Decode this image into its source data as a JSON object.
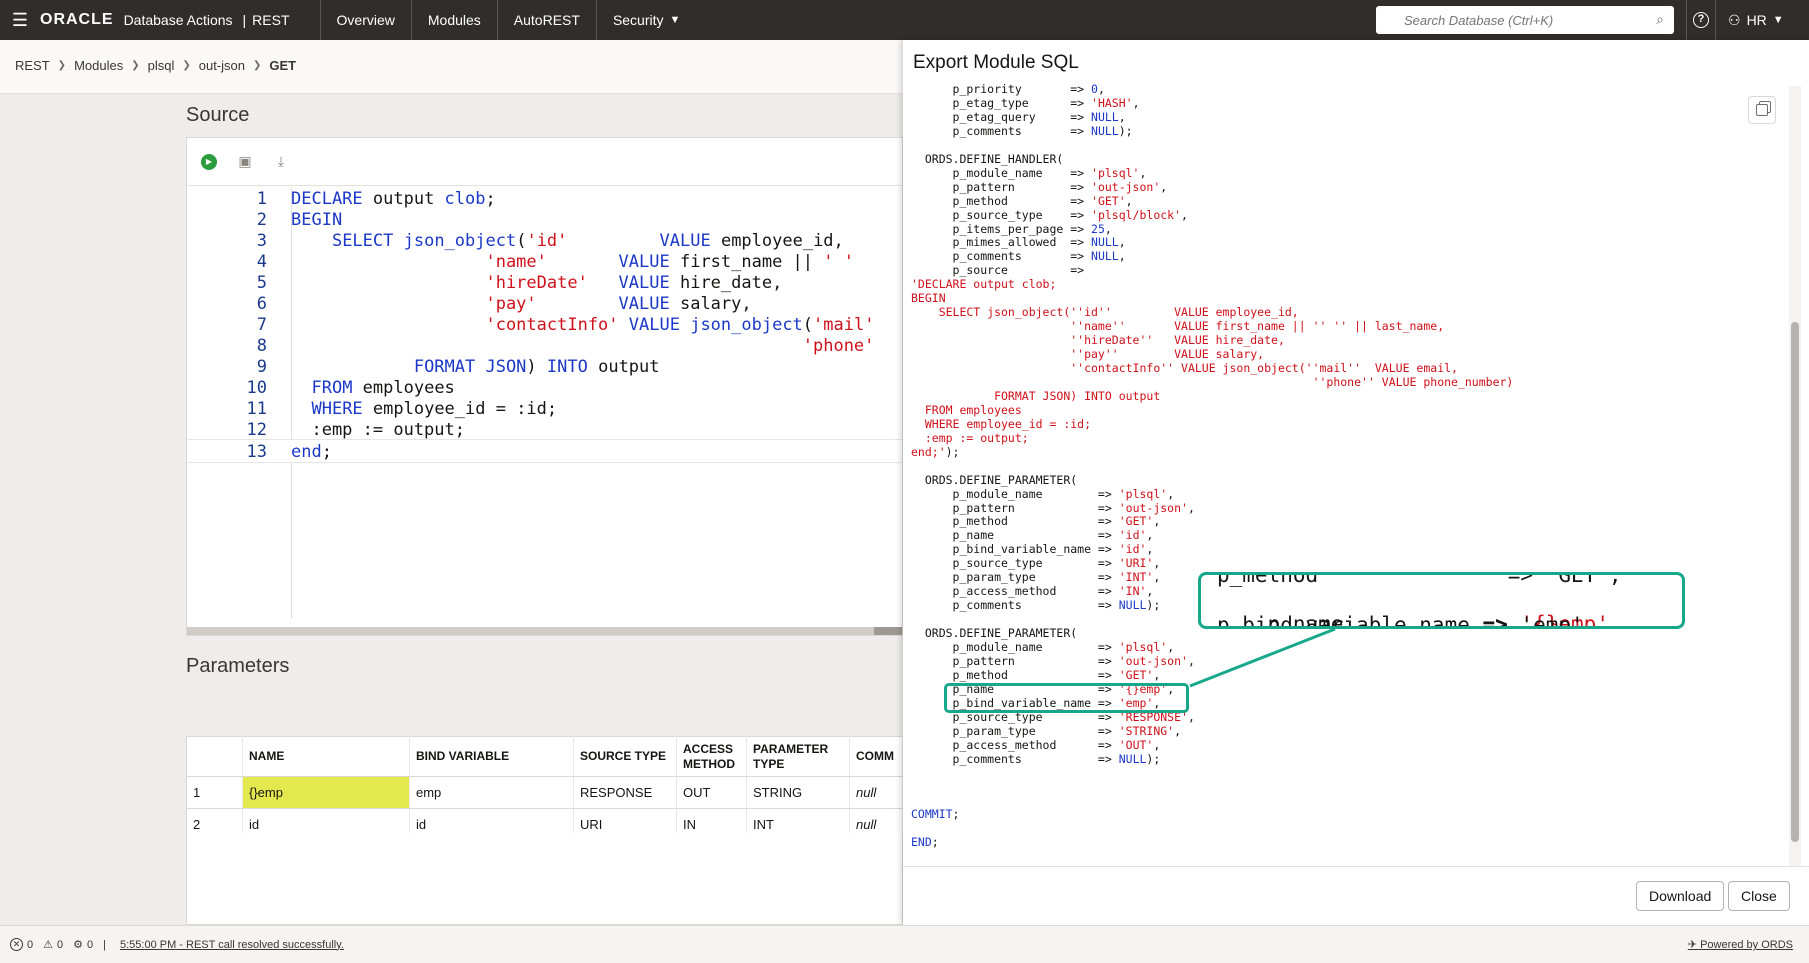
{
  "header": {
    "logo": "ORACLE",
    "app_name": "Database Actions",
    "app_sep": "|",
    "section": "REST",
    "tabs": [
      {
        "label": "Overview"
      },
      {
        "label": "Modules"
      },
      {
        "label": "AutoREST"
      },
      {
        "label": "Security"
      }
    ],
    "search_placeholder": "Search Database (Ctrl+K)",
    "help_label": "?",
    "user": "HR"
  },
  "breadcrumb": [
    "REST",
    "Modules",
    "plsql",
    "out-json",
    "GET"
  ],
  "source": {
    "title": "Source",
    "lines": [
      {
        "n": "1",
        "parts": [
          [
            "kw",
            "DECLARE "
          ],
          [
            "plain",
            "output "
          ],
          [
            "kw",
            "clob"
          ],
          [
            "plain",
            ";"
          ]
        ]
      },
      {
        "n": "2",
        "parts": [
          [
            "kw",
            "BEGIN"
          ]
        ]
      },
      {
        "n": "3",
        "parts": [
          [
            "plain",
            "    "
          ],
          [
            "kw",
            "SELECT "
          ],
          [
            "kw",
            "json_object"
          ],
          [
            "plain",
            "("
          ],
          [
            "str",
            "'id'"
          ],
          [
            "plain",
            "         "
          ],
          [
            "kw",
            "VALUE "
          ],
          [
            "plain",
            "employee_id,"
          ]
        ]
      },
      {
        "n": "4",
        "parts": [
          [
            "plain",
            "                   "
          ],
          [
            "str",
            "'name'"
          ],
          [
            "plain",
            "       "
          ],
          [
            "kw",
            "VALUE "
          ],
          [
            "plain",
            "first_name || "
          ],
          [
            "str",
            "' '"
          ]
        ]
      },
      {
        "n": "5",
        "parts": [
          [
            "plain",
            "                   "
          ],
          [
            "str",
            "'hireDate'"
          ],
          [
            "plain",
            "   "
          ],
          [
            "kw",
            "VALUE "
          ],
          [
            "plain",
            "hire_date,"
          ]
        ]
      },
      {
        "n": "6",
        "parts": [
          [
            "plain",
            "                   "
          ],
          [
            "str",
            "'pay'"
          ],
          [
            "plain",
            "        "
          ],
          [
            "kw",
            "VALUE "
          ],
          [
            "plain",
            "salary,"
          ]
        ]
      },
      {
        "n": "7",
        "parts": [
          [
            "plain",
            "                   "
          ],
          [
            "str",
            "'contactInfo'"
          ],
          [
            "plain",
            " "
          ],
          [
            "kw",
            "VALUE "
          ],
          [
            "kw",
            "json_object"
          ],
          [
            "plain",
            "("
          ],
          [
            "str",
            "'mail'"
          ]
        ]
      },
      {
        "n": "8",
        "parts": [
          [
            "plain",
            "                                                  "
          ],
          [
            "str",
            "'phone'"
          ]
        ]
      },
      {
        "n": "9",
        "parts": [
          [
            "plain",
            "            "
          ],
          [
            "kw",
            "FORMAT JSON"
          ],
          [
            "plain",
            ") "
          ],
          [
            "kw",
            "INTO "
          ],
          [
            "plain",
            "output"
          ]
        ]
      },
      {
        "n": "10",
        "parts": [
          [
            "plain",
            "  "
          ],
          [
            "kw",
            "FROM "
          ],
          [
            "plain",
            "employees"
          ]
        ]
      },
      {
        "n": "11",
        "parts": [
          [
            "plain",
            "  "
          ],
          [
            "kw",
            "WHERE "
          ],
          [
            "plain",
            "employee_id = :id;"
          ]
        ]
      },
      {
        "n": "12",
        "parts": [
          [
            "plain",
            "  :emp := output;"
          ]
        ]
      },
      {
        "n": "13",
        "parts": [
          [
            "kw",
            "end"
          ],
          [
            "plain",
            ";"
          ]
        ]
      }
    ]
  },
  "parameters": {
    "title": "Parameters",
    "columns": [
      "NAME",
      "BIND VARIABLE",
      "SOURCE TYPE",
      "ACCESS METHOD",
      "PARAMETER TYPE",
      "COMM"
    ],
    "rows": [
      {
        "num": "1",
        "name": "{}emp",
        "bind": "emp",
        "source": "RESPONSE",
        "access": "OUT",
        "ptype": "STRING",
        "comment": "null"
      },
      {
        "num": "2",
        "name": "id",
        "bind": "id",
        "source": "URI",
        "access": "IN",
        "ptype": "INT",
        "comment": "null"
      }
    ]
  },
  "drawer": {
    "title": "Export Module SQL",
    "download_label": "Download",
    "close_label": "Close",
    "sql_lines": [
      [
        [
          "plain",
          "      p_priority       => "
        ],
        [
          "kw",
          "0"
        ],
        [
          "plain",
          ","
        ]
      ],
      [
        [
          "plain",
          "      p_etag_type      => "
        ],
        [
          "str",
          "'HASH'"
        ],
        [
          "plain",
          ","
        ]
      ],
      [
        [
          "plain",
          "      p_etag_query     => "
        ],
        [
          "kw",
          "NULL"
        ],
        [
          "plain",
          ","
        ]
      ],
      [
        [
          "plain",
          "      p_comments       => "
        ],
        [
          "kw",
          "NULL"
        ],
        [
          "plain",
          ");"
        ]
      ],
      [
        [
          "plain",
          ""
        ]
      ],
      [
        [
          "plain",
          "  ORDS.DEFINE_HANDLER("
        ]
      ],
      [
        [
          "plain",
          "      p_module_name    => "
        ],
        [
          "str",
          "'plsql'"
        ],
        [
          "plain",
          ","
        ]
      ],
      [
        [
          "plain",
          "      p_pattern        => "
        ],
        [
          "str",
          "'out-json'"
        ],
        [
          "plain",
          ","
        ]
      ],
      [
        [
          "plain",
          "      p_method         => "
        ],
        [
          "str",
          "'GET'"
        ],
        [
          "plain",
          ","
        ]
      ],
      [
        [
          "plain",
          "      p_source_type    => "
        ],
        [
          "str",
          "'plsql/block'"
        ],
        [
          "plain",
          ","
        ]
      ],
      [
        [
          "plain",
          "      p_items_per_page => "
        ],
        [
          "kw",
          "25"
        ],
        [
          "plain",
          ","
        ]
      ],
      [
        [
          "plain",
          "      p_mimes_allowed  => "
        ],
        [
          "kw",
          "NULL"
        ],
        [
          "plain",
          ","
        ]
      ],
      [
        [
          "plain",
          "      p_comments       => "
        ],
        [
          "kw",
          "NULL"
        ],
        [
          "plain",
          ","
        ]
      ],
      [
        [
          "plain",
          "      p_source         =>"
        ]
      ],
      [
        [
          "str",
          "'DECLARE output clob;"
        ]
      ],
      [
        [
          "str",
          "BEGIN"
        ]
      ],
      [
        [
          "str",
          "    SELECT json_object(''id''         VALUE employee_id,"
        ]
      ],
      [
        [
          "str",
          "                       ''name''       VALUE first_name || '' '' || last_name,"
        ]
      ],
      [
        [
          "str",
          "                       ''hireDate''   VALUE hire_date,"
        ]
      ],
      [
        [
          "str",
          "                       ''pay''        VALUE salary,"
        ]
      ],
      [
        [
          "str",
          "                       ''contactInfo'' VALUE json_object(''mail''  VALUE email,"
        ]
      ],
      [
        [
          "str",
          "                                                          ''phone'' VALUE phone_number)"
        ]
      ],
      [
        [
          "str",
          "            FORMAT JSON) INTO output"
        ]
      ],
      [
        [
          "str",
          "  FROM employees"
        ]
      ],
      [
        [
          "str",
          "  WHERE employee_id = :id;"
        ]
      ],
      [
        [
          "str",
          "  :emp := output;"
        ]
      ],
      [
        [
          "str",
          "end;'"
        ],
        [
          "plain",
          ");"
        ]
      ],
      [
        [
          "plain",
          ""
        ]
      ],
      [
        [
          "plain",
          "  ORDS.DEFINE_PARAMETER("
        ]
      ],
      [
        [
          "plain",
          "      p_module_name        => "
        ],
        [
          "str",
          "'plsql'"
        ],
        [
          "plain",
          ","
        ]
      ],
      [
        [
          "plain",
          "      p_pattern            => "
        ],
        [
          "str",
          "'out-json'"
        ],
        [
          "plain",
          ","
        ]
      ],
      [
        [
          "plain",
          "      p_method             => "
        ],
        [
          "str",
          "'GET'"
        ],
        [
          "plain",
          ","
        ]
      ],
      [
        [
          "plain",
          "      p_name               => "
        ],
        [
          "str",
          "'id'"
        ],
        [
          "plain",
          ","
        ]
      ],
      [
        [
          "plain",
          "      p_bind_variable_name => "
        ],
        [
          "str",
          "'id'"
        ],
        [
          "plain",
          ","
        ]
      ],
      [
        [
          "plain",
          "      p_source_type        => "
        ],
        [
          "str",
          "'URI'"
        ],
        [
          "plain",
          ","
        ]
      ],
      [
        [
          "plain",
          "      p_param_type         => "
        ],
        [
          "str",
          "'INT'"
        ],
        [
          "plain",
          ","
        ]
      ],
      [
        [
          "plain",
          "      p_access_method      => "
        ],
        [
          "str",
          "'IN'"
        ],
        [
          "plain",
          ","
        ]
      ],
      [
        [
          "plain",
          "      p_comments           => "
        ],
        [
          "kw",
          "NULL"
        ],
        [
          "plain",
          ");"
        ]
      ],
      [
        [
          "plain",
          ""
        ]
      ],
      [
        [
          "plain",
          "  ORDS.DEFINE_PARAMETER("
        ]
      ],
      [
        [
          "plain",
          "      p_module_name        => "
        ],
        [
          "str",
          "'plsql'"
        ],
        [
          "plain",
          ","
        ]
      ],
      [
        [
          "plain",
          "      p_pattern            => "
        ],
        [
          "str",
          "'out-json'"
        ],
        [
          "plain",
          ","
        ]
      ],
      [
        [
          "plain",
          "      p_method             => "
        ],
        [
          "str",
          "'GET'"
        ],
        [
          "plain",
          ","
        ]
      ],
      [
        [
          "plain",
          "      p_name               => "
        ],
        [
          "str",
          "'{}emp'"
        ],
        [
          "plain",
          ","
        ]
      ],
      [
        [
          "plain",
          "      p_bind_variable_name => "
        ],
        [
          "str",
          "'emp'"
        ],
        [
          "plain",
          ","
        ]
      ],
      [
        [
          "plain",
          "      p_source_type        => "
        ],
        [
          "str",
          "'RESPONSE'"
        ],
        [
          "plain",
          ","
        ]
      ],
      [
        [
          "plain",
          "      p_param_type         => "
        ],
        [
          "str",
          "'STRING'"
        ],
        [
          "plain",
          ","
        ]
      ],
      [
        [
          "plain",
          "      p_access_method      => "
        ],
        [
          "str",
          "'OUT'"
        ],
        [
          "plain",
          ","
        ]
      ],
      [
        [
          "plain",
          "      p_comments           => "
        ],
        [
          "kw",
          "NULL"
        ],
        [
          "plain",
          ");"
        ]
      ],
      [
        [
          "plain",
          ""
        ]
      ],
      [
        [
          "plain",
          ""
        ]
      ],
      [
        [
          "plain",
          ""
        ]
      ],
      [
        [
          "kw",
          "COMMIT"
        ],
        [
          "plain",
          ";"
        ]
      ],
      [
        [
          "plain",
          ""
        ]
      ],
      [
        [
          "kw",
          "END"
        ],
        [
          "plain",
          ";"
        ]
      ]
    ]
  },
  "callout": {
    "top_text": "p_method               => 'GET',",
    "key": "p_name",
    "arrow": "=>",
    "value": "'{}emp'",
    "comma": ",",
    "bottom_text": "p_bind_variable_name => 'emp',"
  },
  "status": {
    "errors": "0",
    "warnings": "0",
    "tasks": "0",
    "sep": "|",
    "message": "5:55:00 PM - REST call resolved successfully.",
    "powered": "Powered by ORDS"
  }
}
